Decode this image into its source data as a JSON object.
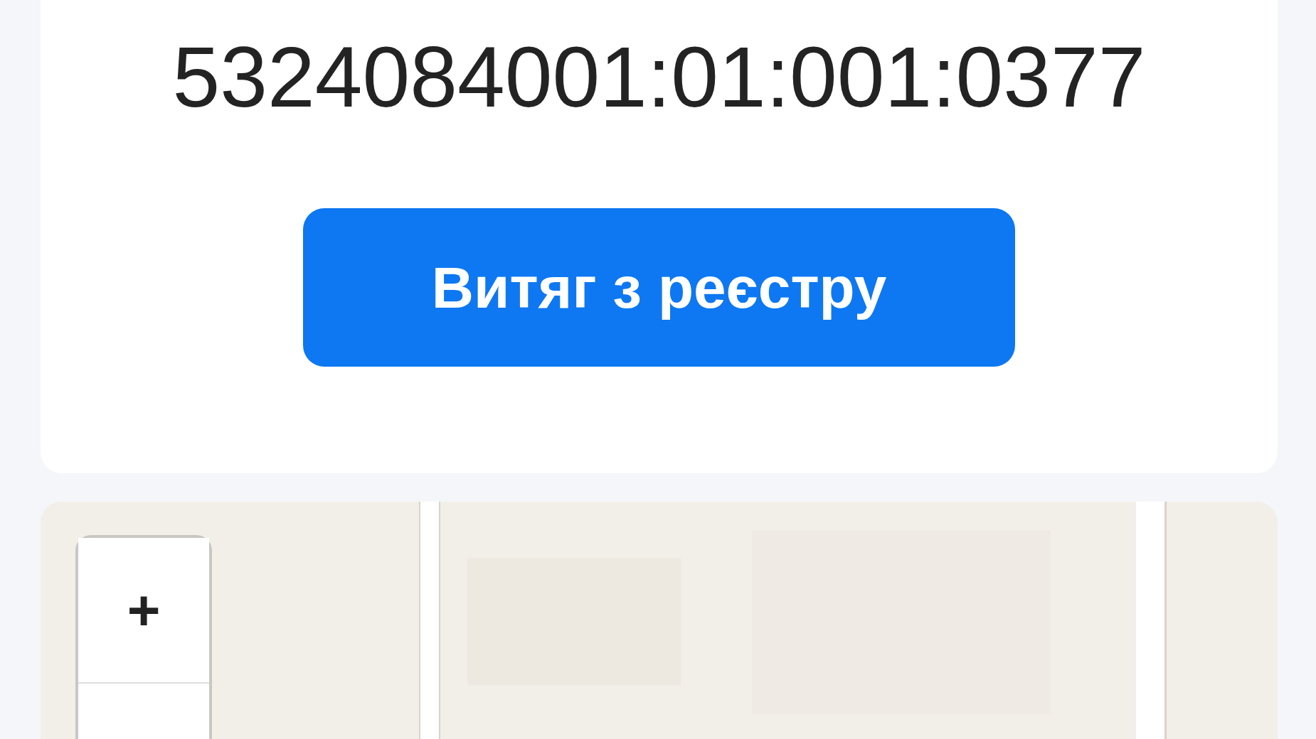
{
  "parcel": {
    "cadastral_number": "5324084001:01:001:0377",
    "button": "Витяг з реєстру"
  },
  "map": {
    "kind": "picture",
    "zoom_in": "+"
  }
}
